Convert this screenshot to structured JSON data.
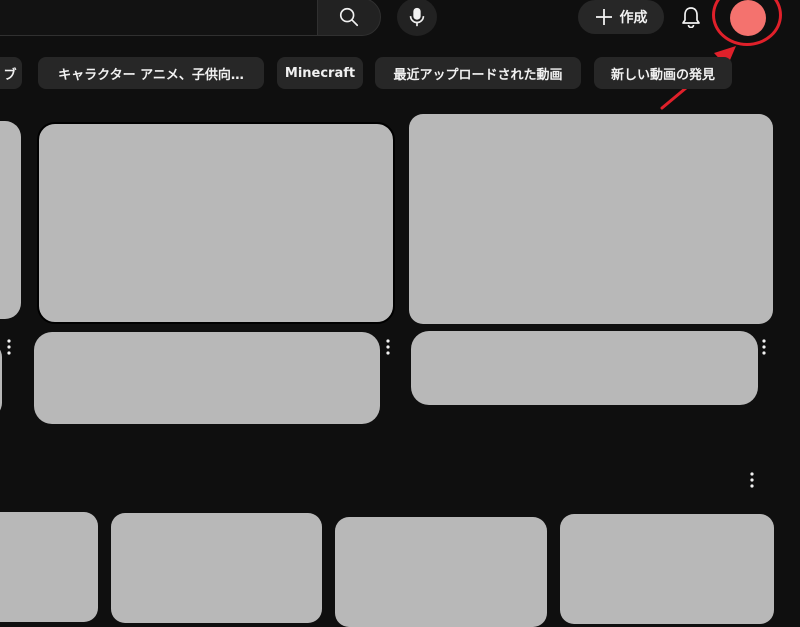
{
  "header": {
    "search_placeholder": "",
    "create_label": "作成",
    "icons": {
      "search": "search-icon",
      "mic": "mic-icon",
      "create": "plus-icon",
      "notifications": "bell-icon"
    },
    "avatar_color": "#f4726e",
    "highlight_color": "#e0202a"
  },
  "chips": [
    {
      "label": "ブ"
    },
    {
      "label": "キャラクター アニメ、子供向…"
    },
    {
      "label": "Minecraft"
    },
    {
      "label": "最近アップロードされた動画"
    },
    {
      "label": "新しい動画の発見"
    }
  ],
  "colors": {
    "background": "#0f0f0f",
    "chip_bg": "#272727",
    "placeholder": "#b8b8b8"
  }
}
